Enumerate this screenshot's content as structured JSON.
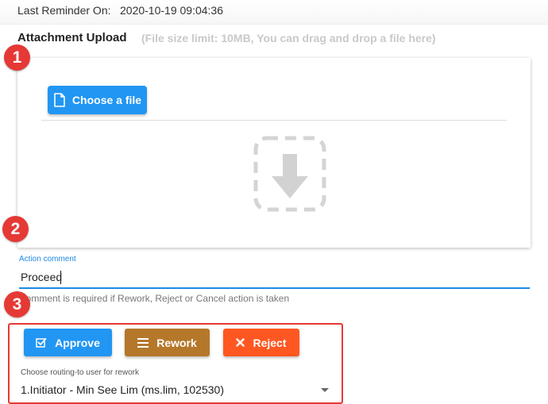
{
  "reminder": {
    "label": "Last Reminder On:",
    "value": "2020-10-19 09:04:36"
  },
  "upload": {
    "title": "Attachment Upload",
    "hint": "(File size limit: 10MB, You can drag and drop a file here)",
    "choose_label": "Choose a file",
    "icons": {
      "choose": "file-icon",
      "drop": "download-arrow-icon"
    }
  },
  "badges": [
    "1",
    "2",
    "3"
  ],
  "comment": {
    "label": "Action comment",
    "value": "Proceed",
    "hint": "Comment is required if Rework, Reject or Cancel action is taken"
  },
  "actions": {
    "approve_label": "Approve",
    "rework_label": "Rework",
    "reject_label": "Reject",
    "icons": {
      "approve": "checkbox-icon",
      "rework": "list-icon",
      "reject": "close-icon"
    }
  },
  "routing": {
    "label": "Choose routing-to user for rework",
    "selected": "1.Initiator - Min See Lim (ms.lim, 102530)"
  },
  "colors": {
    "primary": "#2196f3",
    "rework": "#b5782a",
    "reject": "#ff5722",
    "highlight": "#e53935",
    "hint_text": "#c9c9c9"
  }
}
